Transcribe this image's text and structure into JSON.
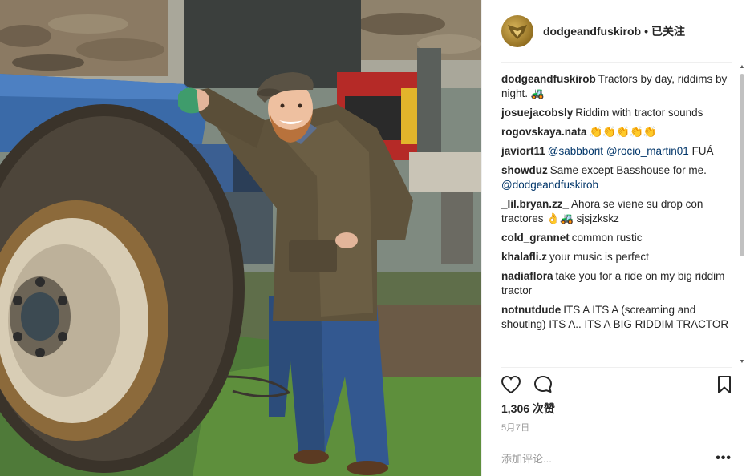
{
  "post": {
    "username": "dodgeandfuskirob",
    "separator": "•",
    "follow_state": "已关注",
    "photo_alt": "Man in waxed jacket and flat cap leaning against a muddy blue tractor"
  },
  "comments": [
    {
      "author": "dodgeandfuskirob",
      "parts": [
        {
          "text": "Tractors by day, riddims by night. 🚜"
        }
      ]
    },
    {
      "author": "josuejacobsly",
      "parts": [
        {
          "text": "Riddim with tractor sounds"
        }
      ]
    },
    {
      "author": "rogovskaya.nata",
      "parts": [
        {
          "text": "👏👏👏👏👏"
        }
      ]
    },
    {
      "author": "javiort11",
      "parts": [
        {
          "text": "@sabbborit",
          "mention": true
        },
        {
          "text": " "
        },
        {
          "text": "@rocio_martin01",
          "mention": true
        },
        {
          "text": " FUÁ"
        }
      ]
    },
    {
      "author": "showduz",
      "parts": [
        {
          "text": "Same except Basshouse for me. "
        },
        {
          "text": "@dodgeandfuskirob",
          "mention": true
        }
      ]
    },
    {
      "author": "_lil.bryan.zz_",
      "parts": [
        {
          "text": "Ahora se viene su drop con tractores 👌🚜 sjsjzkskz"
        }
      ]
    },
    {
      "author": "cold_grannet",
      "parts": [
        {
          "text": "common rustic"
        }
      ]
    },
    {
      "author": "khalafli.z",
      "parts": [
        {
          "text": "your music is perfect"
        }
      ]
    },
    {
      "author": "nadiaflora",
      "parts": [
        {
          "text": "take you for a ride on my big riddim tractor"
        }
      ]
    },
    {
      "author": "notnutdude",
      "parts": [
        {
          "text": "ITS A ITS A (screaming and shouting) ITS A.. ITS A BIG RIDDIM TRACTOR"
        }
      ]
    }
  ],
  "actions": {
    "like_icon": "heart-icon",
    "comment_icon": "speech-bubble-icon",
    "save_icon": "bookmark-icon"
  },
  "likes": "1,306 次赞",
  "date": "5月7日",
  "add_comment_placeholder": "添加评论...",
  "more_label": "•••",
  "scrollbar": {
    "up": "▲",
    "down": "▼"
  }
}
